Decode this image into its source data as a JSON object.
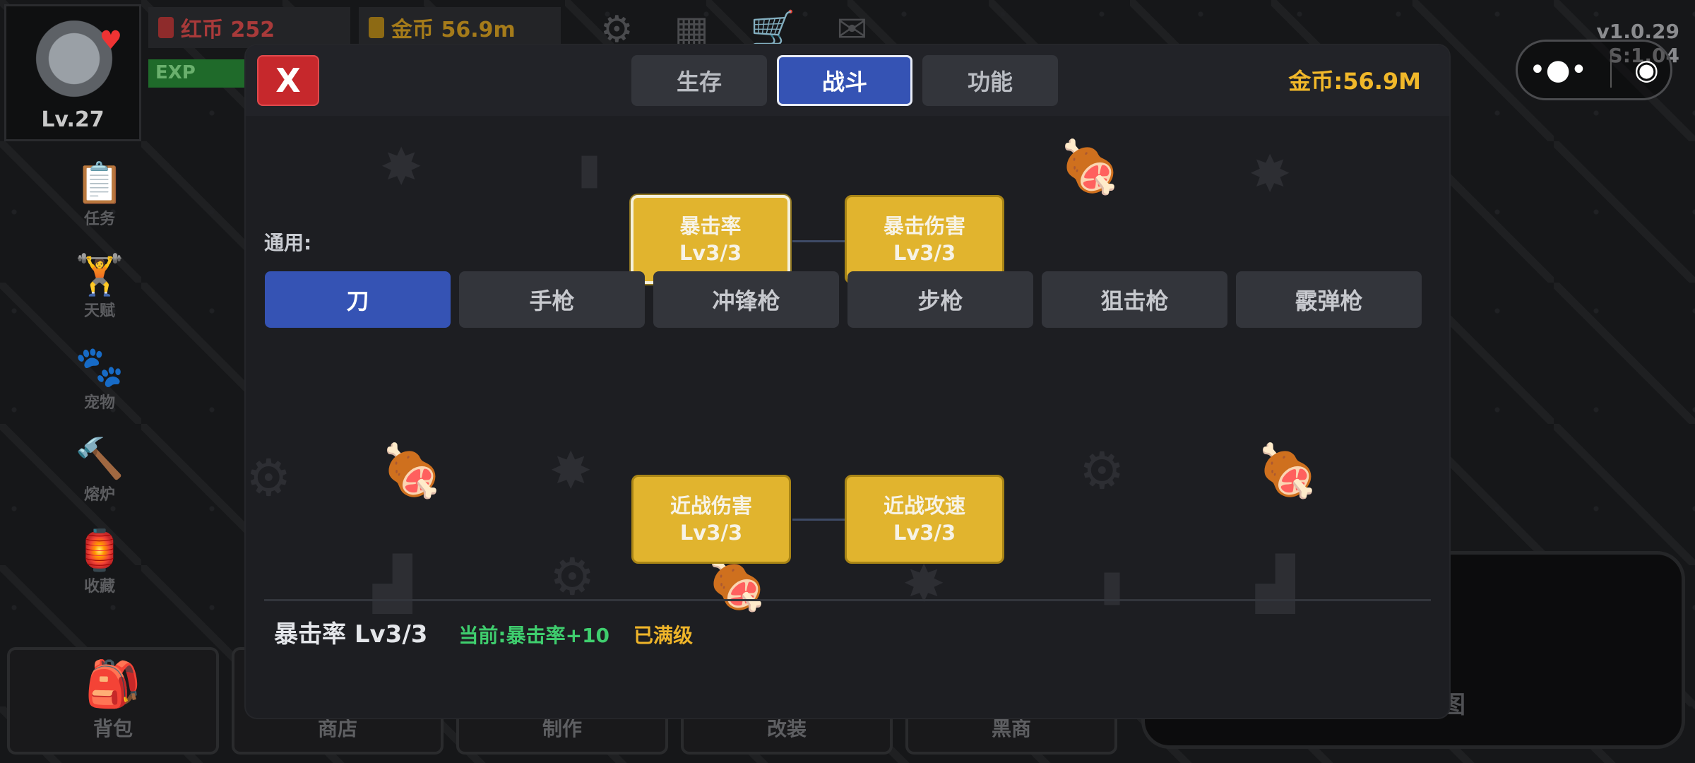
{
  "hud": {
    "level": "Lv.27",
    "red_coin_label": "红币 252",
    "gold_coin_label": "金币 56.9m",
    "exp_label": "EXP",
    "version": "v1.0.29",
    "version_sub": "S:1.04"
  },
  "sidebar": {
    "items": [
      {
        "label": "任务",
        "icon": "clipboard-check-icon"
      },
      {
        "label": "天赋",
        "icon": "dumbbell-icon"
      },
      {
        "label": "宠物",
        "icon": "paw-icon"
      },
      {
        "label": "熔炉",
        "icon": "hammer-icon"
      },
      {
        "label": "收藏",
        "icon": "collection-icon"
      }
    ]
  },
  "bottombar": {
    "items": [
      {
        "label": "背包",
        "icon": "backpack-icon"
      },
      {
        "label": "商店",
        "icon": ""
      },
      {
        "label": "制作",
        "icon": ""
      },
      {
        "label": "改装",
        "icon": ""
      },
      {
        "label": "黑商",
        "icon": ""
      }
    ],
    "right_panel_text": "图"
  },
  "modal": {
    "close_label": "X",
    "tabs": [
      {
        "label": "生存",
        "active": false
      },
      {
        "label": "战斗",
        "active": true
      },
      {
        "label": "功能",
        "active": false
      }
    ],
    "gold_display": "金币:56.9M",
    "general_label": "通用:",
    "general_nodes": [
      {
        "name": "暴击率",
        "level": "Lv3/3",
        "selected": true
      },
      {
        "name": "暴击伤害",
        "level": "Lv3/3",
        "selected": false
      }
    ],
    "categories": [
      {
        "label": "刀",
        "active": true
      },
      {
        "label": "手枪",
        "active": false
      },
      {
        "label": "冲锋枪",
        "active": false
      },
      {
        "label": "步枪",
        "active": false
      },
      {
        "label": "狙击枪",
        "active": false
      },
      {
        "label": "霰弹枪",
        "active": false
      }
    ],
    "category_nodes": [
      {
        "name": "近战伤害",
        "level": "Lv3/3"
      },
      {
        "name": "近战攻速",
        "level": "Lv3/3"
      }
    ],
    "detail": {
      "name": "暴击率  Lv3/3",
      "current": "当前:暴击率+10",
      "status": "已满级"
    }
  },
  "colors": {
    "accent_blue": "#3553b4",
    "node_gold": "#e1b42e",
    "close_red": "#c6282c",
    "gold_text": "#f1b82a",
    "current_green": "#3fce6e"
  }
}
